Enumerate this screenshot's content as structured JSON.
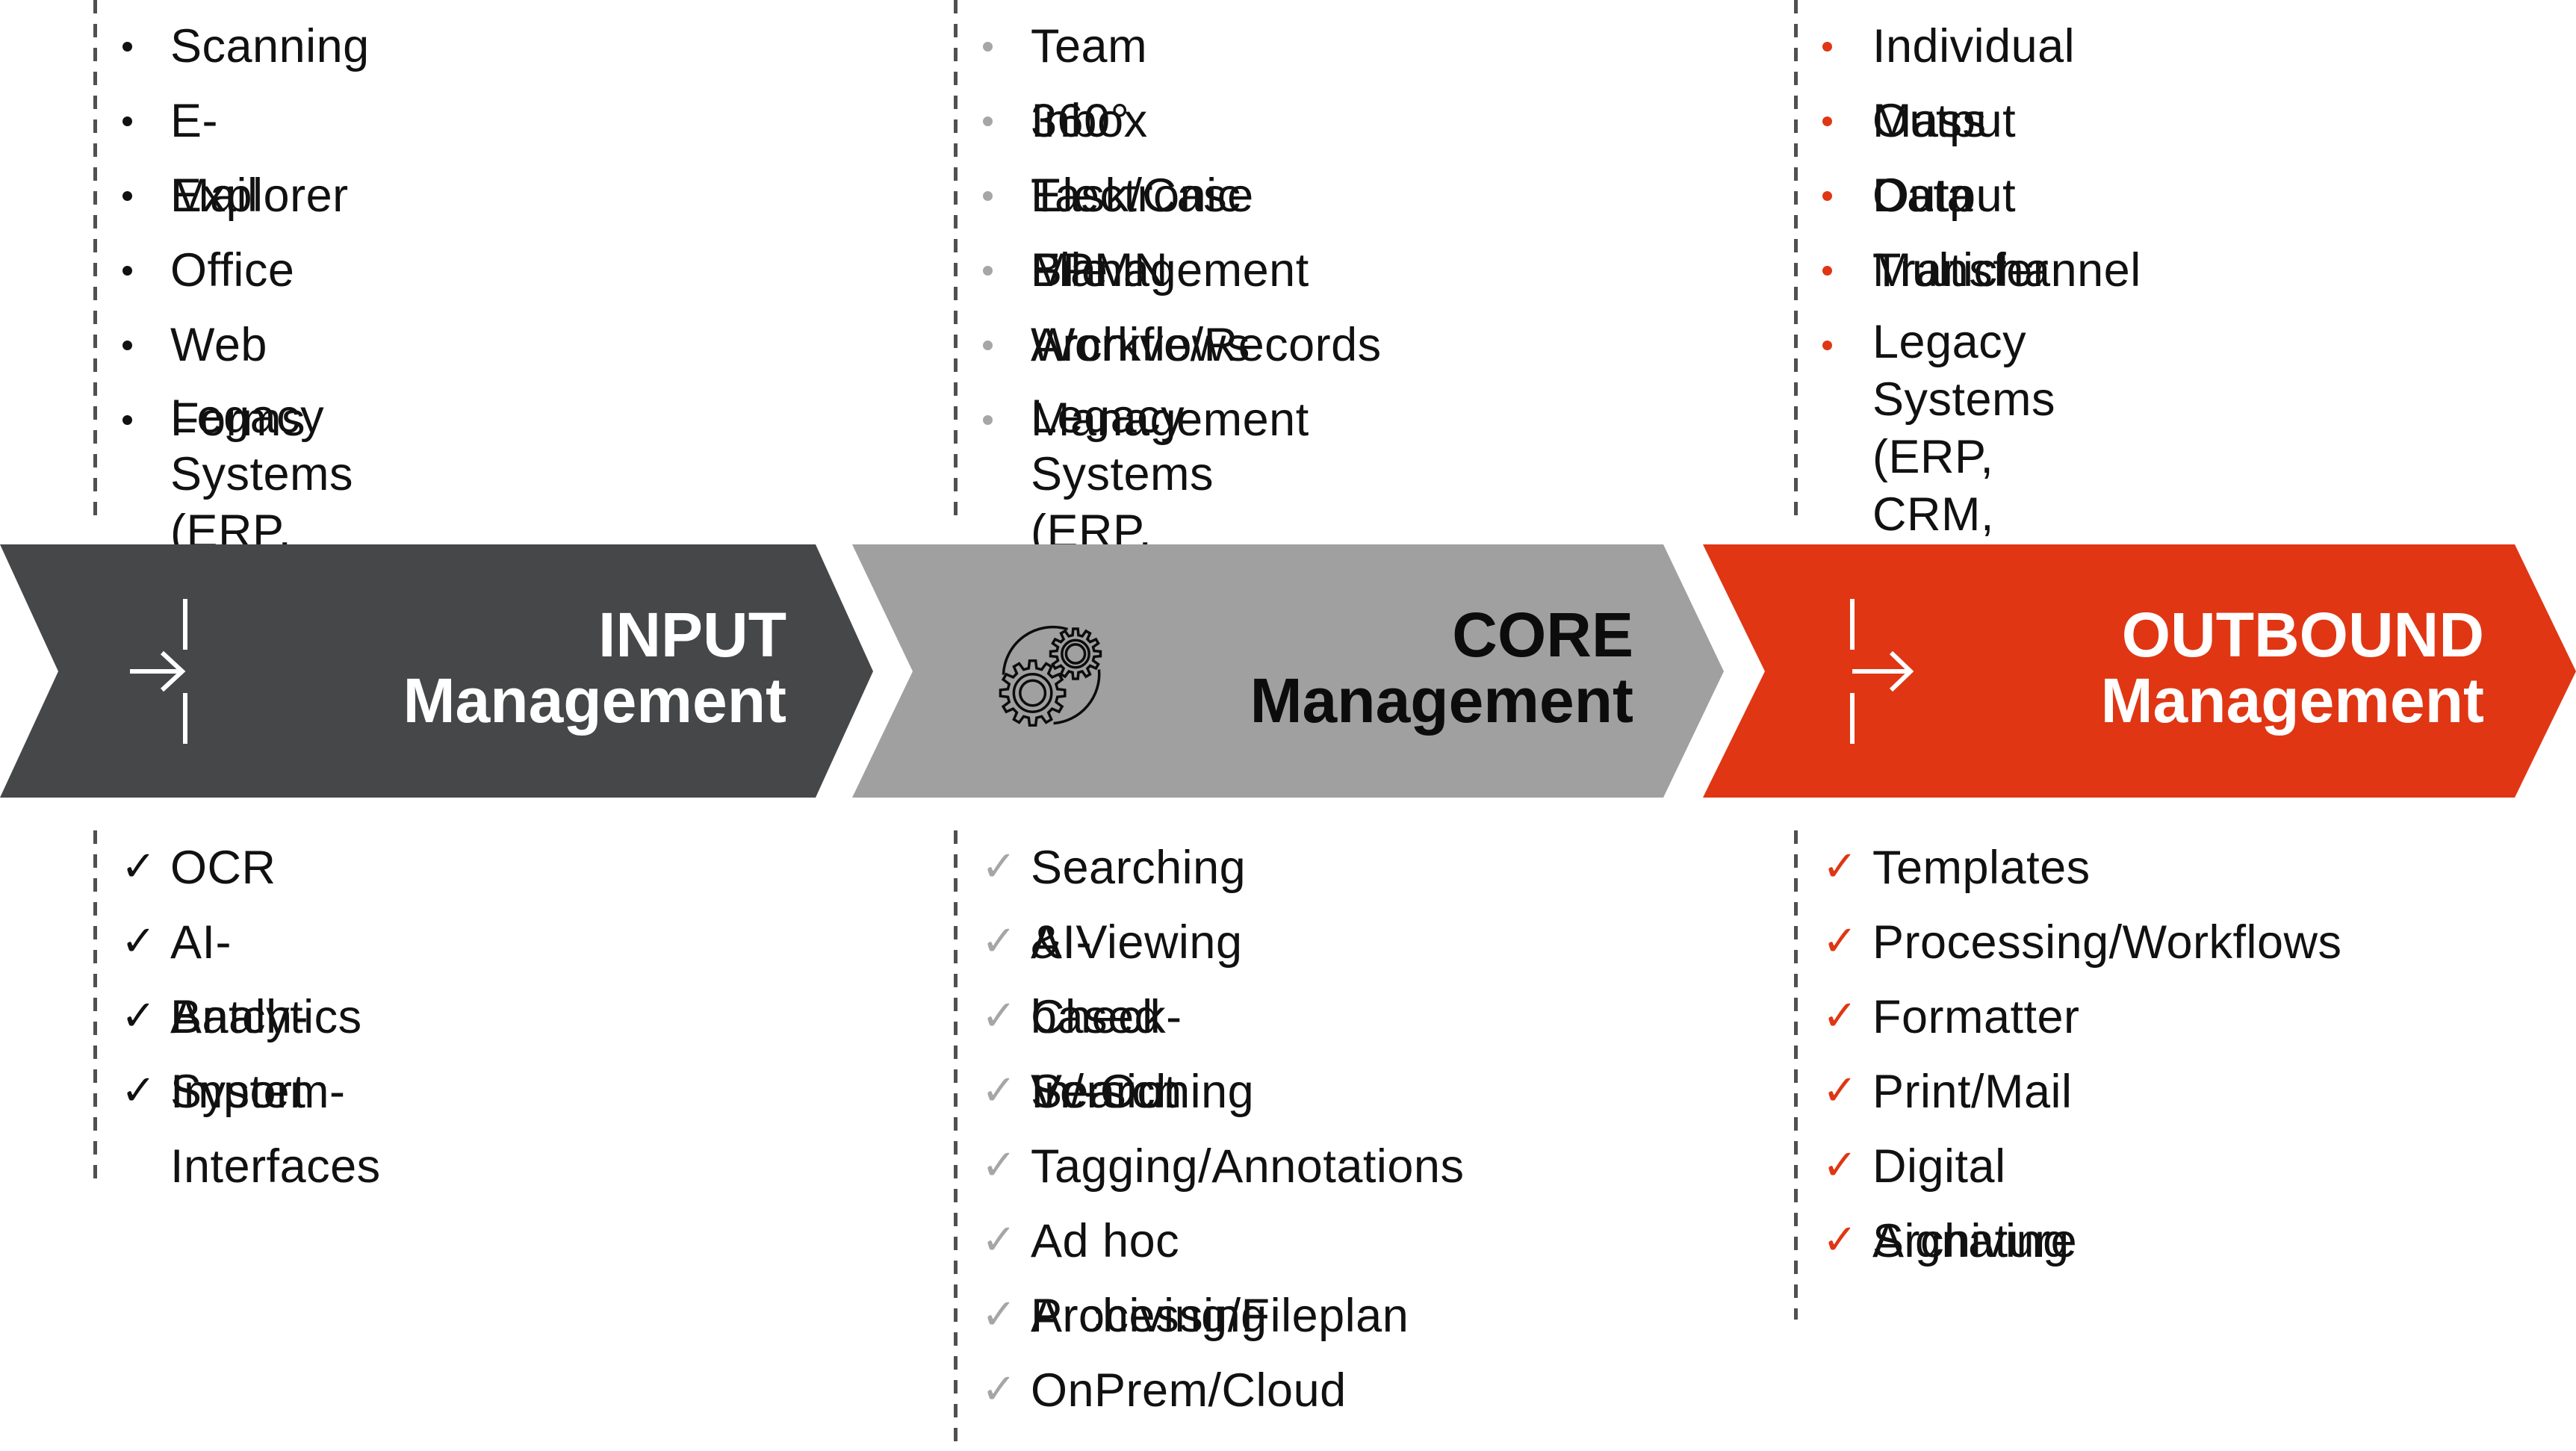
{
  "colors": {
    "input": "#454748",
    "core": "#a0a0a0",
    "outbound": "#e03614",
    "divider": "#505050",
    "bullet_input": "#111111",
    "bullet_core": "#a6a6a6",
    "bullet_outbound": "#e03614",
    "title_input": "#ffffff",
    "title_core": "#0c0c0c",
    "title_outbound": "#ffffff"
  },
  "stages": [
    {
      "id": "input",
      "title_line1": "INPUT",
      "title_line2": "Management",
      "icon": "input-arrow-icon",
      "sources": [
        "Scanning",
        "E-Mail",
        "Explorer",
        "Office",
        "Web Forms",
        "Legacy Systems\n(ERP, CRM, etc.)"
      ],
      "features": [
        "OCR",
        "AI-Analytics",
        "Batch-Import",
        "System-Interfaces"
      ]
    },
    {
      "id": "core",
      "title_line1": "CORE",
      "title_line2": "Management",
      "icon": "gears-icon",
      "sources": [
        "Team Inbox",
        "360° Electronic File",
        "Task/Case Management",
        "BPMN Workflows",
        "Archive/Records Management",
        "Legacy Systems\n(ERP, CRM, etc.)"
      ],
      "features": [
        "Searching & Viewing",
        "AI-based Search",
        "Check-In/-Out",
        "Versioning",
        "Tagging/Annotations",
        "Ad hoc Processing",
        "Archiving/Fileplan",
        "OnPrem/Cloud"
      ]
    },
    {
      "id": "outbound",
      "title_line1": "OUTBOUND",
      "title_line2": "Management",
      "icon": "output-arrow-icon",
      "sources": [
        "Individual Output",
        "Mass Output",
        "Data Transfer",
        "Multichannel",
        "Legacy Systems\n(ERP, CRM, etc.)"
      ],
      "features": [
        "Templates",
        "Processing/Workflows",
        "Formatter",
        "Print/Mail",
        "Digital Signature",
        "Archiving"
      ]
    }
  ],
  "glyphs": {
    "bullet": "•",
    "check": "✓"
  }
}
